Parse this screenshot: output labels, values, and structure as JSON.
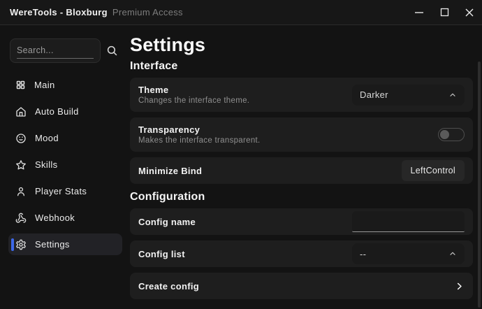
{
  "titlebar": {
    "app_title": "WereTools - Bloxburg",
    "subtitle": "Premium Access"
  },
  "sidebar": {
    "search": {
      "placeholder": "Search..."
    },
    "items": [
      {
        "label": "Main",
        "icon": "grid-icon",
        "active": false
      },
      {
        "label": "Auto Build",
        "icon": "home-icon",
        "active": false
      },
      {
        "label": "Mood",
        "icon": "smiley-icon",
        "active": false
      },
      {
        "label": "Skills",
        "icon": "star-icon",
        "active": false
      },
      {
        "label": "Player Stats",
        "icon": "person-icon",
        "active": false
      },
      {
        "label": "Webhook",
        "icon": "webhook-icon",
        "active": false
      },
      {
        "label": "Settings",
        "icon": "gear-icon",
        "active": true
      }
    ]
  },
  "settings_page": {
    "title": "Settings",
    "sections": [
      {
        "heading": "Interface",
        "rows": [
          {
            "title": "Theme",
            "subtitle": "Changes the interface theme.",
            "control": "dropdown",
            "value": "Darker"
          },
          {
            "title": "Transparency",
            "subtitle": "Makes the interface transparent.",
            "control": "toggle",
            "value": "off"
          },
          {
            "title": "Minimize Bind",
            "control": "keybind",
            "value": "LeftControl"
          }
        ]
      },
      {
        "heading": "Configuration",
        "rows": [
          {
            "title": "Config name",
            "control": "text-input",
            "value": ""
          },
          {
            "title": "Config list",
            "control": "dropdown",
            "value": "--"
          },
          {
            "title": "Create config",
            "control": "navigate"
          }
        ]
      }
    ]
  },
  "colors": {
    "accent_blue": "#3d68e8",
    "window_bg": "#131313",
    "titlebar_bg": "#171717",
    "row_bg": "#1e1e1e",
    "control_bg": "#1a1a1a",
    "keybind_bg": "#272727"
  }
}
